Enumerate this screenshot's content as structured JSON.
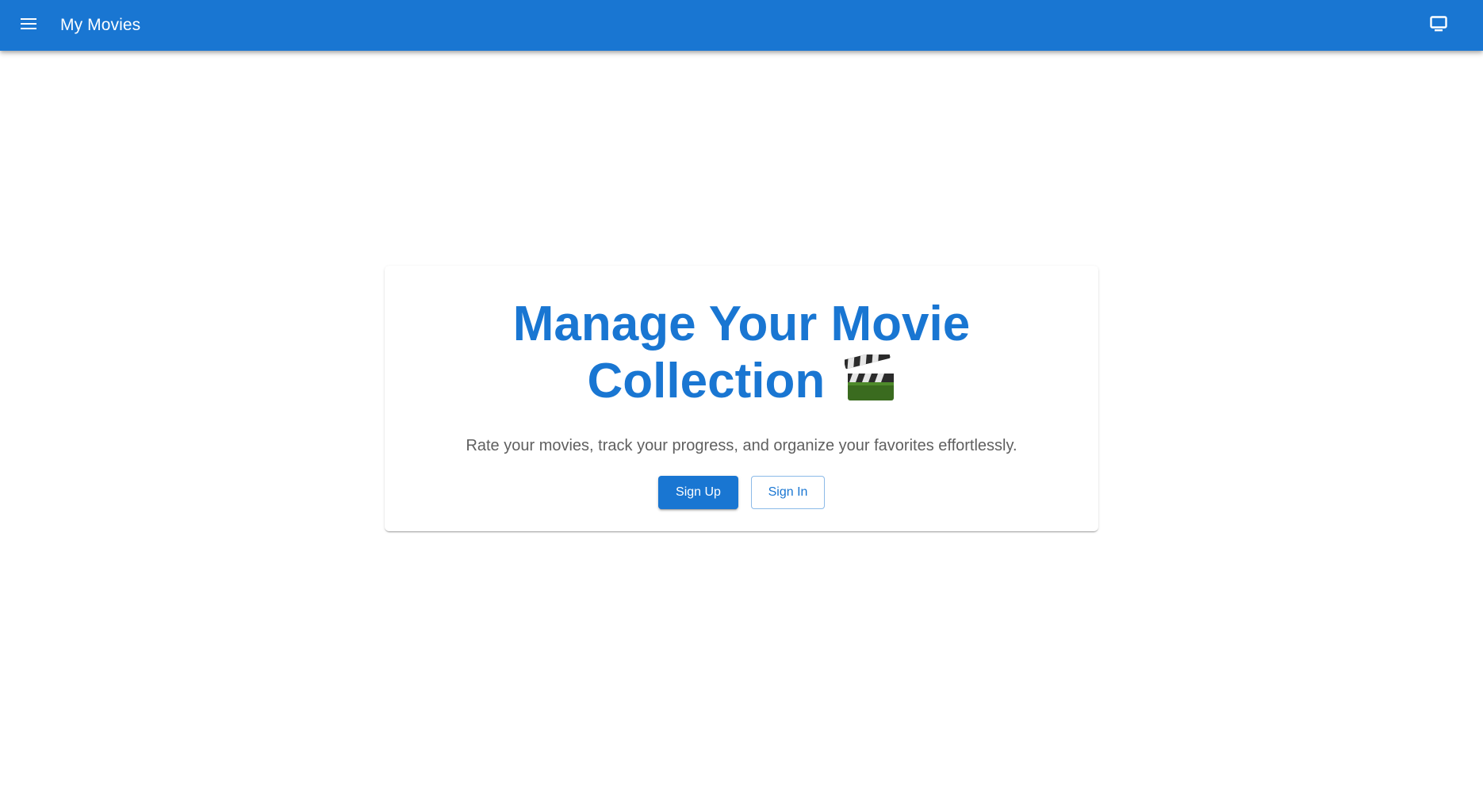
{
  "appbar": {
    "title": "My Movies",
    "menu_icon": "menu-icon",
    "monitor_icon": "monitor-icon",
    "color": "#1976d2"
  },
  "hero": {
    "headline_line1": "Manage Your Movie",
    "headline_line2": "Collection",
    "headline_emoji_icon": "clapperboard-icon",
    "subtitle": "Rate your movies, track your progress, and organize your favorites effortlessly.",
    "sign_up_label": "Sign Up",
    "sign_in_label": "Sign In"
  }
}
